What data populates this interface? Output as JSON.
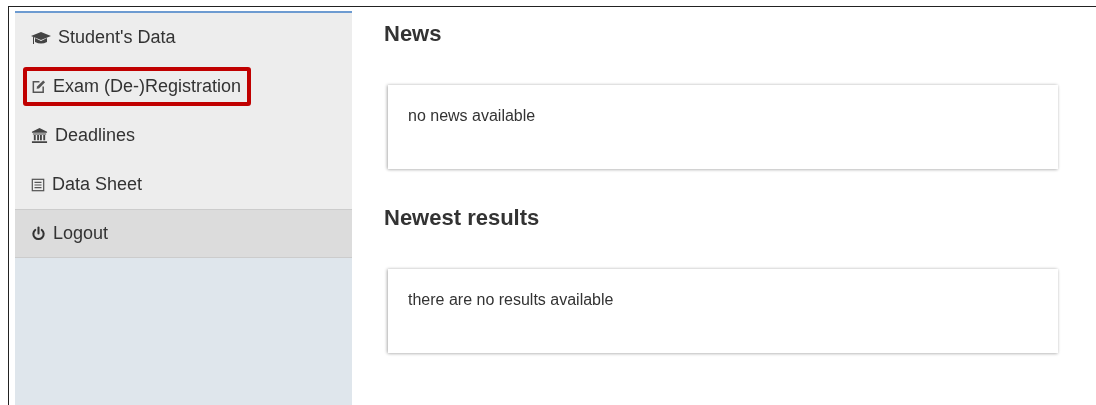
{
  "sidebar": {
    "items": [
      {
        "label": "Student's Data",
        "highlighted": false,
        "kind": "cap"
      },
      {
        "label": "Exam (De-)Registration",
        "highlighted": true,
        "kind": "edit"
      },
      {
        "label": "Deadlines",
        "highlighted": false,
        "kind": "bank"
      },
      {
        "label": "Data Sheet",
        "highlighted": false,
        "kind": "sheet"
      },
      {
        "label": "Logout",
        "highlighted": false,
        "kind": "logout"
      }
    ]
  },
  "sections": [
    {
      "heading": "News",
      "message": "no news available"
    },
    {
      "heading": "Newest results",
      "message": "there are no results available"
    }
  ]
}
